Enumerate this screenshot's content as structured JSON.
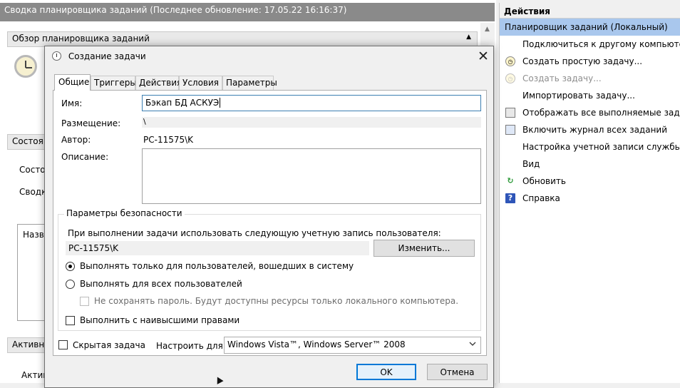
{
  "background": {
    "title": "Сводка планировщика заданий (Последнее обновление: 17.05.22 16:16:37)",
    "overview_section": "Обзор планировщика заданий",
    "status_section": "Состоян",
    "status_line1": "Состо",
    "status_line2": "Сводка",
    "box_text": "Назва",
    "active_section": "Активны",
    "active_text": "Актив"
  },
  "actions": {
    "header": "Действия",
    "selected": "Планировщик заданий (Локальный)",
    "items": [
      {
        "label": "Подключиться к другому компьютеру...",
        "icon": "none",
        "enabled": true
      },
      {
        "label": "Создать простую задачу...",
        "icon": "wizard-icon",
        "enabled": true
      },
      {
        "label": "Создать задачу...",
        "icon": "new-task-icon",
        "enabled": false
      },
      {
        "label": "Импортировать задачу...",
        "icon": "none",
        "enabled": true
      },
      {
        "label": "Отображать все выполняемые задачи",
        "icon": "running-tasks-icon",
        "enabled": true
      },
      {
        "label": "Включить журнал всех заданий",
        "icon": "journal-icon",
        "enabled": true
      },
      {
        "label": "Настройка учетной записи службы AT",
        "icon": "none",
        "enabled": true
      },
      {
        "label": "Вид",
        "icon": "none",
        "enabled": true
      },
      {
        "label": "Обновить",
        "icon": "refresh-icon",
        "enabled": true
      },
      {
        "label": "Справка",
        "icon": "help-icon",
        "enabled": true
      }
    ]
  },
  "dialog": {
    "title": "Создание задачи",
    "tabs": [
      "Общие",
      "Триггеры",
      "Действия",
      "Условия",
      "Параметры"
    ],
    "active_tab": "Общие",
    "name_label": "Имя:",
    "name_value": "Бэкап БД АСКУЭ",
    "location_label": "Размещение:",
    "location_value": "\\",
    "author_label": "Автор:",
    "author_value": "PC-11575\\K",
    "description_label": "Описание:",
    "description_value": "",
    "security": {
      "legend": "Параметры безопасности",
      "account_prompt": "При выполнении задачи использовать следующую учетную запись пользователя:",
      "account_value": "PC-11575\\K",
      "change_button": "Изменить...",
      "radio_logged_on": "Выполнять только для пользователей, вошедших в систему",
      "radio_all_users": "Выполнять для всех пользователей",
      "no_store_password": "Не сохранять пароль. Будут доступны ресурсы только локального компьютера.",
      "highest_privileges": "Выполнить с наивысшими правами",
      "selected_radio": "logged_on",
      "highest_privileges_checked": false,
      "no_store_password_checked": false
    },
    "hidden_label": "Скрытая задача",
    "hidden_checked": false,
    "configure_label": "Настроить для:",
    "configure_value": "Windows Vista™, Windows Server™ 2008",
    "ok_button": "OK",
    "cancel_button": "Отмена"
  },
  "colors": {
    "selection": "#a9c7ed",
    "focus_border": "#3c7fb1",
    "default_button_border": "#0078d7",
    "titlebar_inactive": "#8a8a8a"
  }
}
